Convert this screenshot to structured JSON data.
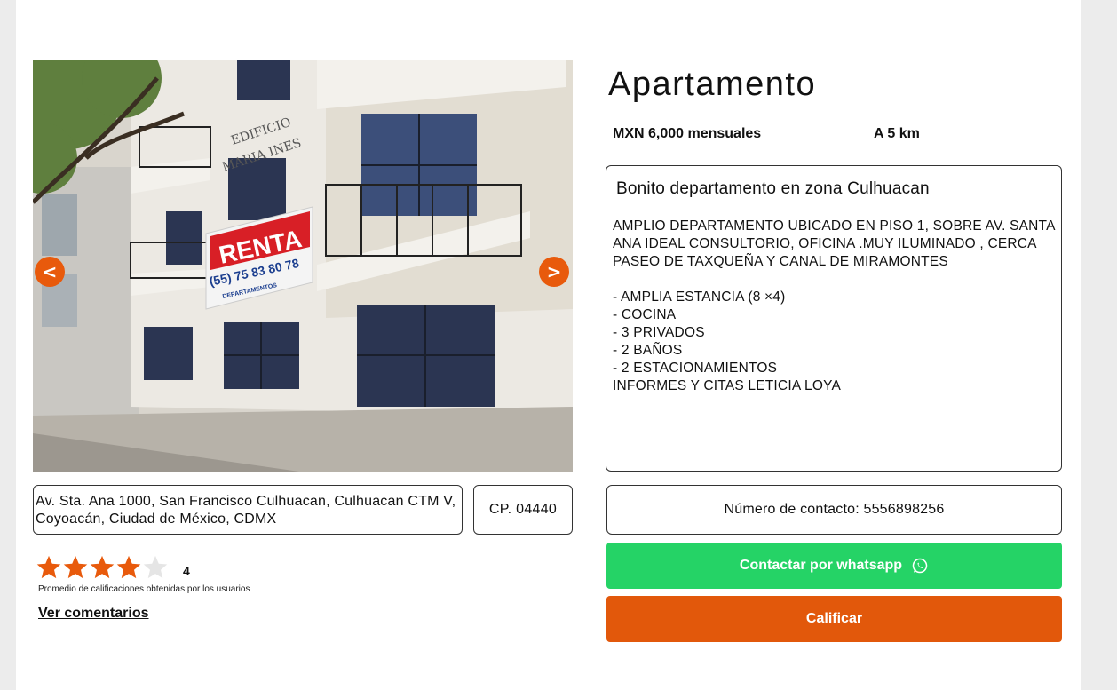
{
  "listing": {
    "title": "Apartamento",
    "price": "MXN 6,000 mensuales",
    "distance": "A 5 km"
  },
  "gallery": {
    "prev_label": "<",
    "next_label": ">",
    "photo": {
      "building_sign_line1": "EDIFICIO",
      "building_sign_line2": "MARIA INES",
      "banner_word": "RENTA",
      "banner_phone": "(55) 75 83 80 78",
      "banner_sub": "DEPARTAMENTOS"
    }
  },
  "location": {
    "address": "Av. Sta. Ana 1000, San Francisco Culhuacan, Culhuacan CTM V, Coyoacán, Ciudad de México, CDMX",
    "postal_code": "CP. 04440"
  },
  "rating": {
    "value": "4",
    "score": 4,
    "max": 5,
    "caption": "Promedio de calificaciones obtenidas por los usuarios",
    "comments_link": "Ver comentarios",
    "star_color": "#e85a0c",
    "empty_star_color": "#e5e5e5"
  },
  "description": {
    "heading": "Bonito departamento en zona Culhuacan",
    "body": "AMPLIO DEPARTAMENTO UBICADO EN PISO 1, SOBRE AV. SANTA ANA IDEAL CONSULTORIO, OFICINA .MUY ILUMINADO , CERCA PASEO DE TAXQUEÑA Y CANAL DE MIRAMONTES\n\n- AMPLIA ESTANCIA (8 ×4)\n- COCINA\n- 3 PRIVADOS\n- 2 BAÑOS\n- 2 ESTACIONAMIENTOS\nINFORMES Y CITAS LETICIA LOYA"
  },
  "contact": {
    "phone_text": "Número de contacto: 5556898256",
    "whatsapp_label": "Contactar por whatsapp",
    "whatsapp_icon": "whatsapp-icon",
    "rate_label": "Calificar"
  },
  "colors": {
    "accent": "#e85a0c",
    "whatsapp": "#25d366"
  }
}
